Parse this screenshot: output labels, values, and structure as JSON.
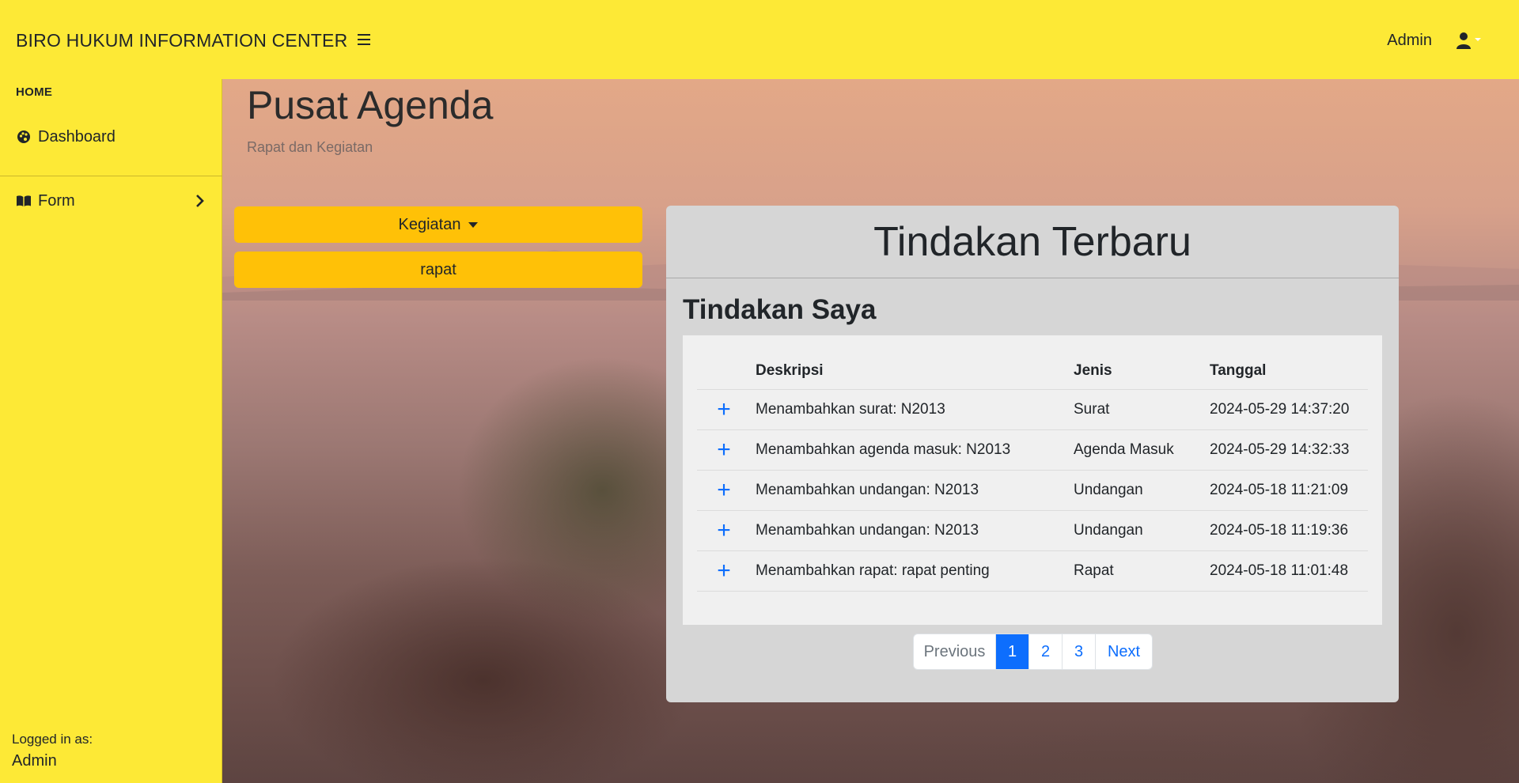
{
  "navbar": {
    "brand": "BIRO HUKUM INFORMATION CENTER",
    "user": "Admin"
  },
  "sidebar": {
    "heading": "HOME",
    "items": [
      {
        "label": "Dashboard",
        "icon": "palette-icon"
      },
      {
        "label": "Form",
        "icon": "book-icon"
      }
    ],
    "footer_label": "Logged in as:",
    "footer_user": "Admin"
  },
  "main": {
    "title": "Pusat Agenda",
    "subtitle": "Rapat dan Kegiatan",
    "buttons": {
      "kegiatan": "Kegiatan",
      "rapat": "rapat"
    }
  },
  "card": {
    "header": "Tindakan Terbaru",
    "subheader": "Tindakan Saya",
    "columns": [
      "Deskripsi",
      "Jenis",
      "Tanggal"
    ],
    "rows": [
      {
        "deskripsi": "Menambahkan surat: N2013",
        "jenis": "Surat",
        "tanggal": "2024-05-29 14:37:20"
      },
      {
        "deskripsi": "Menambahkan agenda masuk: N2013",
        "jenis": "Agenda Masuk",
        "tanggal": "2024-05-29 14:32:33"
      },
      {
        "deskripsi": "Menambahkan undangan: N2013",
        "jenis": "Undangan",
        "tanggal": "2024-05-18 11:21:09"
      },
      {
        "deskripsi": "Menambahkan undangan: N2013",
        "jenis": "Undangan",
        "tanggal": "2024-05-18 11:19:36"
      },
      {
        "deskripsi": "Menambahkan rapat: rapat penting",
        "jenis": "Rapat",
        "tanggal": "2024-05-18 11:01:48"
      }
    ],
    "row_icon": "+",
    "pagination": {
      "previous": "Previous",
      "pages": [
        "1",
        "2",
        "3"
      ],
      "active": "1",
      "next": "Next"
    }
  },
  "colors": {
    "navbar_bg": "#fde936",
    "button_bg": "#ffc107",
    "link": "#0d6efd",
    "card_bg": "#d6d6d6"
  }
}
